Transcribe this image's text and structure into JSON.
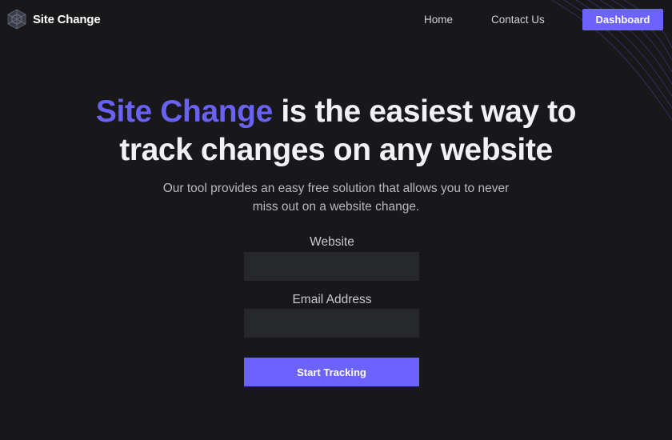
{
  "nav": {
    "brand": "Site Change",
    "links": [
      {
        "label": "Home"
      },
      {
        "label": "Contact Us"
      }
    ],
    "dashboard_label": "Dashboard"
  },
  "hero": {
    "title_accent": "Site Change",
    "title_rest_line1": " is the easiest way to",
    "title_line2": "track changes on any website",
    "subtitle_line1": "Our tool provides an easy free solution that allows you to never",
    "subtitle_line2": "miss out on a website change."
  },
  "form": {
    "website_label": "Website",
    "website_value": "",
    "email_label": "Email Address",
    "email_value": "",
    "submit_label": "Start Tracking"
  },
  "colors": {
    "background": "#18181b",
    "accent": "#6c63ff",
    "title_accent": "#6861f2",
    "input_bg": "#27282c"
  }
}
